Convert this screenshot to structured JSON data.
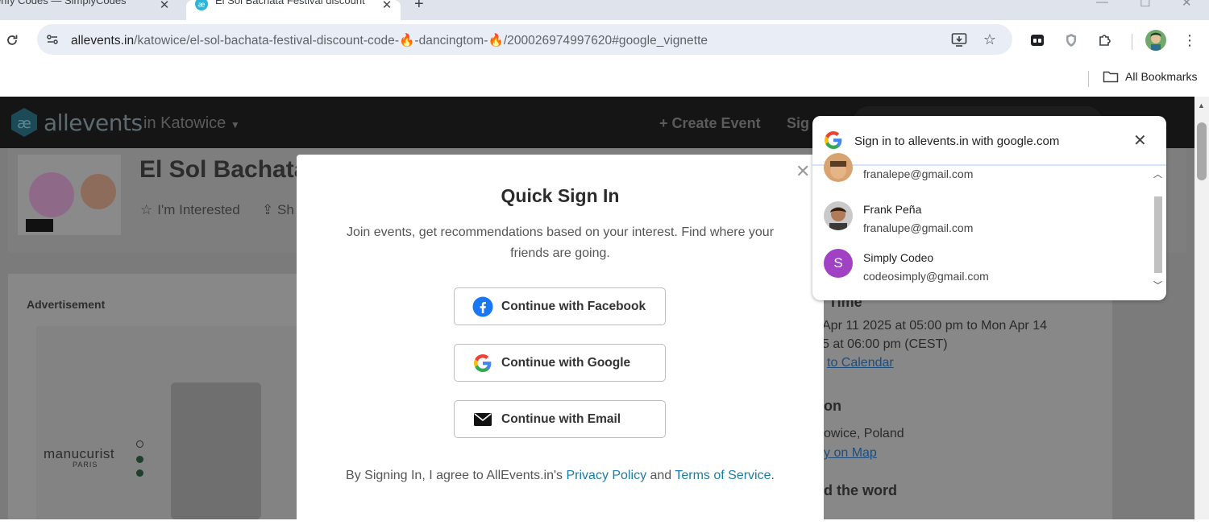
{
  "browser": {
    "tabs": [
      {
        "title": "erify Codes — SimplyCodes",
        "active": false
      },
      {
        "title": "El Sol Bachata Festival discount",
        "active": true
      }
    ],
    "new_tab_label": "+",
    "url": {
      "host": "allevents.in",
      "path": "/katowice/el-sol-bachata-festival-discount-code-🔥-dancingtom-🔥/200026974997620#google_vignette"
    },
    "bookmarks_label": "All Bookmarks"
  },
  "site": {
    "logo_text": "allevents",
    "city": "in Katowice",
    "create_event": "+ Create Event",
    "sign_partial": "Sig"
  },
  "event": {
    "title": "El Sol Bachata",
    "interested": "I'm Interested",
    "share_partial": "Sh",
    "advertisement": "Advertisement",
    "ad_brand": "manucurist",
    "ad_sub": "PARIS",
    "time_heading": "Time",
    "time_line1": "Apr 11 2025 at 05:00 pm to Mon Apr 14",
    "time_line2": "5 at 06:00 pm (CEST)",
    "add_calendar": "to Calendar",
    "location_heading": "on",
    "location": "owice, Poland",
    "map_link": "y on Map",
    "spread_heading": "d the word"
  },
  "modal": {
    "title": "Quick Sign In",
    "description": "Join events, get recommendations based on your interest. Find where your friends are going.",
    "facebook": "Continue with Facebook",
    "google": "Continue with Google",
    "email": "Continue with Email",
    "footer_pre": "By Signing In, I agree to AllEvents.in's ",
    "privacy": "Privacy Policy",
    "and": " and ",
    "terms": "Terms of Service",
    "footer_post": "."
  },
  "google_one_tap": {
    "title": "Sign in to allevents.in with google.com",
    "accounts": [
      {
        "name": "",
        "email": "franalepe@gmail.com"
      },
      {
        "name": "Frank Peña",
        "email": "franalupe@gmail.com"
      },
      {
        "name": "Simply Codeo",
        "email": "codeosimply@gmail.com",
        "initial": "S",
        "avatar_color": "#a142c4"
      }
    ]
  }
}
